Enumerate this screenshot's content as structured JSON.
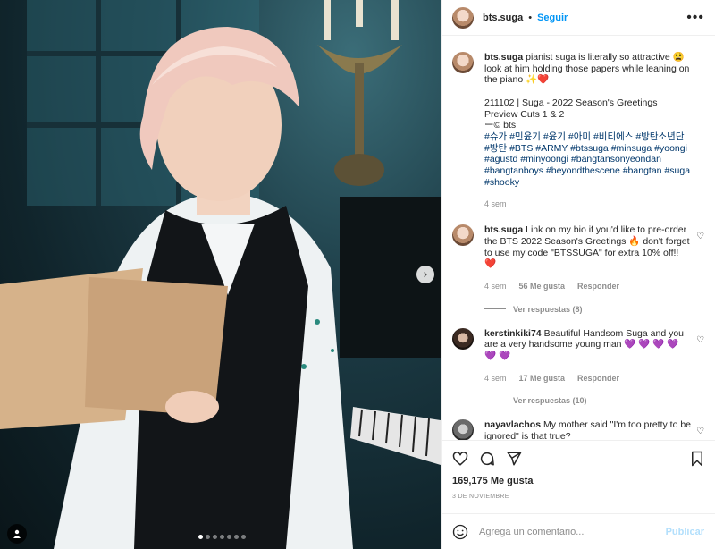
{
  "header": {
    "username": "bts.suga",
    "separator": "•",
    "follow_label": "Seguir",
    "more_icon": "more-horizontal-icon"
  },
  "caption": {
    "username": "bts.suga",
    "text": "pianist suga is literally so attractive 😩 look at him holding those papers while leaning on the piano ✨❤️",
    "line2": "211102 | Suga - 2022 Season's Greetings Preview Cuts 1 & 2",
    "line3": "ー© bts",
    "hashtags": "#슈가 #민윤기 #윤기 #아미 #비티에스 #방탄소년단 #방탄 #BTS #ARMY #btssuga #minsuga #yoongi #agustd #minyoongi #bangtansonyeondan #bangtanboys #beyondthescene #bangtan #suga #shooky",
    "time": "4 sem"
  },
  "comments": [
    {
      "username": "bts.suga",
      "text": "Link on my bio if you'd like to pre-order the BTS 2022 Season's Greetings 🔥 don't forget to use my code \"BTSSUGA\" for extra 10% off!! ❤️",
      "time": "4 sem",
      "likes": "56 Me gusta",
      "reply": "Responder",
      "view_replies": "Ver respuestas (8)"
    },
    {
      "username": "kerstinkiki74",
      "text": "Beautiful Handsom Suga and you are a very handsome young man 💜 💜 💜 💜 💜 💜",
      "time": "4 sem",
      "likes": "17 Me gusta",
      "reply": "Responder",
      "view_replies": "Ver respuestas (10)"
    },
    {
      "username": "nayavlachos",
      "text": "My mother said \"I'm too pretty to be ignored\" is that true?"
    }
  ],
  "actions": {
    "like_icon": "heart-icon",
    "comment_icon": "comment-icon",
    "share_icon": "send-icon",
    "save_icon": "bookmark-icon"
  },
  "likes_count": "169,175 Me gusta",
  "post_date": "3 DE NOVIEMBRE",
  "composer": {
    "placeholder": "Agrega un comentario...",
    "post_label": "Publicar",
    "emoji_icon": "emoji-icon"
  },
  "carousel": {
    "dots_total": 7,
    "active_index": 0
  },
  "photo": {
    "description_icon": "user-tag-icon"
  }
}
